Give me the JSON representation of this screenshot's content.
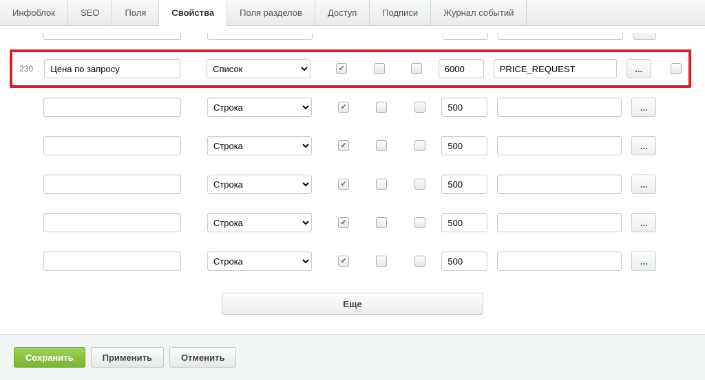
{
  "tabs": [
    {
      "label": "Инфоблок"
    },
    {
      "label": "SEO"
    },
    {
      "label": "Поля"
    },
    {
      "label": "Свойства",
      "active": true
    },
    {
      "label": "Поля разделов"
    },
    {
      "label": "Доступ"
    },
    {
      "label": "Подписи"
    },
    {
      "label": "Журнал событий"
    }
  ],
  "rows": [
    {
      "id": "230",
      "name": "Цена по запросу",
      "type": "Список",
      "cb1": true,
      "cb2": false,
      "cb3": false,
      "num": "6000",
      "code": "PRICE_REQUEST",
      "extra": false,
      "highlight": true
    },
    {
      "id": "",
      "name": "",
      "type": "Строка",
      "cb1": true,
      "cb2": false,
      "cb3": false,
      "num": "500",
      "code": "",
      "extra": false
    },
    {
      "id": "",
      "name": "",
      "type": "Строка",
      "cb1": true,
      "cb2": false,
      "cb3": false,
      "num": "500",
      "code": "",
      "extra": false
    },
    {
      "id": "",
      "name": "",
      "type": "Строка",
      "cb1": true,
      "cb2": false,
      "cb3": false,
      "num": "500",
      "code": "",
      "extra": false
    },
    {
      "id": "",
      "name": "",
      "type": "Строка",
      "cb1": true,
      "cb2": false,
      "cb3": false,
      "num": "500",
      "code": "",
      "extra": false
    },
    {
      "id": "",
      "name": "",
      "type": "Строка",
      "cb1": true,
      "cb2": false,
      "cb3": false,
      "num": "500",
      "code": "",
      "extra": false
    }
  ],
  "more_label": "Еще",
  "more_btn": "...",
  "type_options": [
    "Список",
    "Строка"
  ],
  "footer": {
    "save": "Сохранить",
    "apply": "Применить",
    "cancel": "Отменить"
  }
}
